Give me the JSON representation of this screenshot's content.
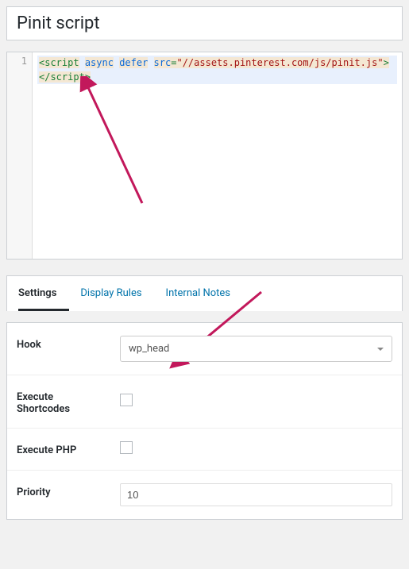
{
  "title": "Pinit script",
  "code": {
    "line_number": "1",
    "tag_open": "script",
    "attr_async": "async",
    "attr_defer": "defer",
    "attr_src_name": "src",
    "attr_src_eq": "=",
    "attr_src_val": "\"//assets.pinterest.com/js/pinit.js\"",
    "tag_close": "/script"
  },
  "tabs": {
    "settings": "Settings",
    "display_rules": "Display Rules",
    "internal_notes": "Internal Notes"
  },
  "settings": {
    "hook_label": "Hook",
    "hook_value": "wp_head",
    "shortcodes_label": "Execute Shortcodes",
    "php_label": "Execute PHP",
    "priority_label": "Priority",
    "priority_value": "10"
  }
}
